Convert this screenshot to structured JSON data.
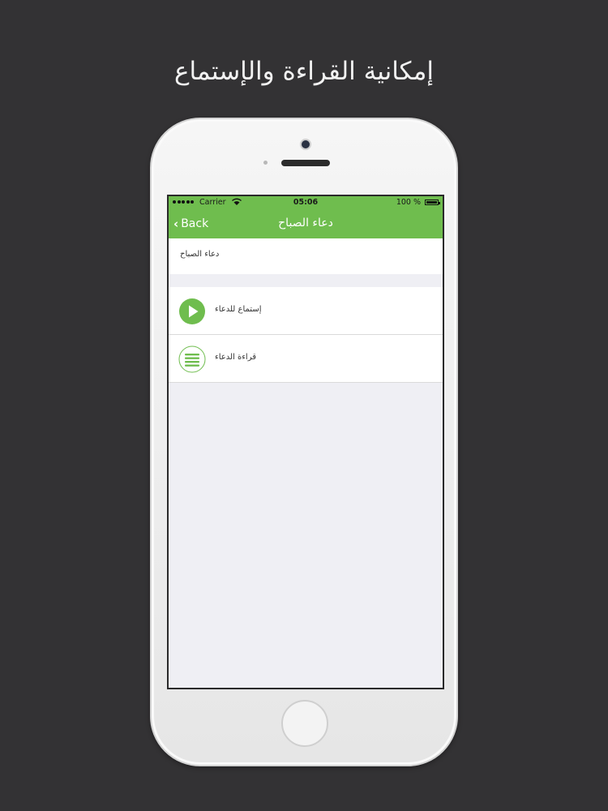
{
  "headline": "إمكانية القراءة والإستماع",
  "status_bar": {
    "carrier": "Carrier",
    "time": "05:06",
    "battery": "100 %"
  },
  "nav": {
    "back_label": "Back",
    "title": "دعاء الصباح"
  },
  "section_header": {
    "title": "دعاء الصباح"
  },
  "options": [
    {
      "label": "إستماع للدعاء",
      "icon": "play-icon"
    },
    {
      "label": "قراءة الدعاء",
      "icon": "lines-icon"
    }
  ],
  "colors": {
    "accent": "#6fbd4e",
    "background": "#333234",
    "screen_bg": "#efeff4"
  }
}
